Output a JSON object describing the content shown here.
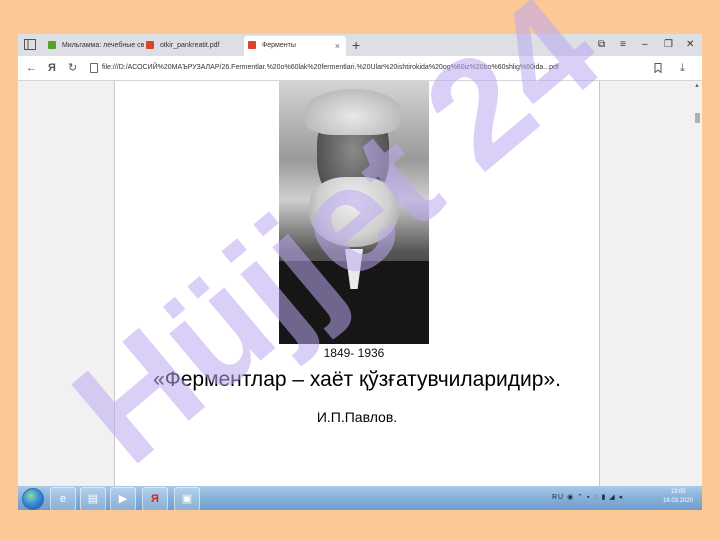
{
  "browser": {
    "tabs": [
      {
        "label": "Мильгамма: лечебные св",
        "icon": "green-leaf-icon"
      },
      {
        "label": "otkir_pankreatit.pdf",
        "icon": "pdf-icon"
      },
      {
        "label": "Ферменты",
        "icon": "pdf-icon"
      }
    ],
    "close_glyph": "×",
    "new_tab_glyph": "+",
    "yandex_glyph": "Я",
    "url": "file:///D:/АСОСИЙ%20МАЪРУЗАЛАР/26.Fermentlar.%20o%60lak%20fermentlari.%20Ular%20ishtirokida%20og%60iz%20bo%60shlig%60ida...pdf"
  },
  "document": {
    "years": "1849- 1936",
    "quote": "«Ферментлар – хаёт қўзғатувчиларидир».",
    "author": "И.П.Павлов."
  },
  "taskbar": {
    "tray_text": "RU",
    "time": "13:05",
    "date": "18.03.2020"
  },
  "watermark": {
    "text": "Hüjjet 24"
  },
  "colors": {
    "frame_background": "#fcc896",
    "watermark": "#b9a7f0",
    "taskbar": "#86b0d8"
  }
}
